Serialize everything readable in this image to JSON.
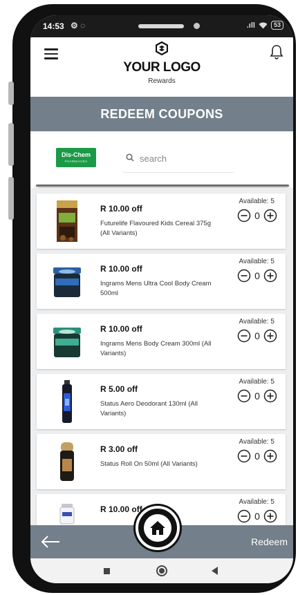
{
  "status_bar": {
    "time": "14:53",
    "left_icons": "⚙ ◌",
    "signal": ".ıll",
    "battery": "53"
  },
  "header": {
    "logo_text": "YOUR LOGO",
    "logo_subtitle": "Rewards"
  },
  "page_title": "REDEEM COUPONS",
  "store": {
    "logo_main": "Dis-Chem",
    "logo_sub": "PHARMACIES"
  },
  "search": {
    "placeholder": "search"
  },
  "coupons": [
    {
      "deal": "R 10.00 off",
      "description": "Futurelife Flavoured Kids Cereal 375g (All Variants)",
      "available": "Available: 5",
      "quantity": "0"
    },
    {
      "deal": "R 10.00 off",
      "description": "Ingrams Mens Ultra Cool Body Cream 500ml",
      "available": "Available: 5",
      "quantity": "0"
    },
    {
      "deal": "R 10.00 off",
      "description": "Ingrams Mens Body Cream 300ml (All Variants)",
      "available": "Available: 5",
      "quantity": "0"
    },
    {
      "deal": "R 5.00 off",
      "description": "Status Aero Deodorant 130ml (All Variants)",
      "available": "Available: 5",
      "quantity": "0"
    },
    {
      "deal": "R 3.00 off",
      "description": "Status Roll On 50ml (All Variants)",
      "available": "Available: 5",
      "quantity": "0"
    },
    {
      "deal": "R 10.00 off",
      "description": "",
      "available": "Available: 5",
      "quantity": "0"
    }
  ],
  "bottom_bar": {
    "redeem_label": "Redeem"
  },
  "colors": {
    "band": "#737f8a",
    "store_green": "#1a9a47",
    "list_bg": "#eceeef"
  },
  "icons": [
    "menu-icon",
    "bell-icon",
    "search-icon",
    "minus-circle-icon",
    "plus-circle-icon",
    "back-arrow-icon",
    "home-icon"
  ]
}
